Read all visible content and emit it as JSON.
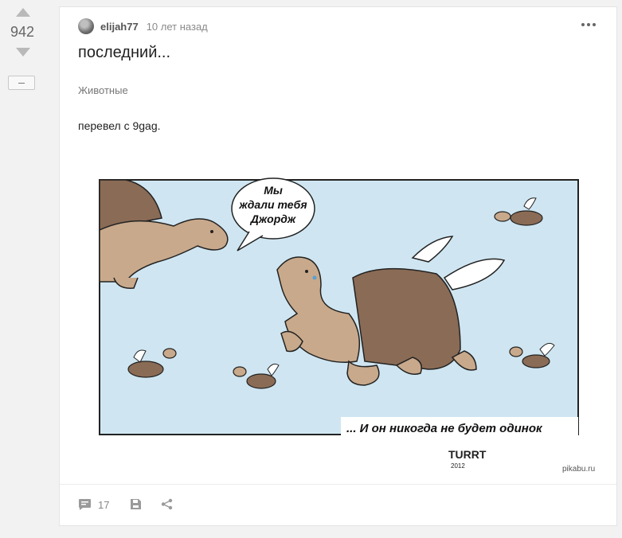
{
  "vote": {
    "rating": "942"
  },
  "post": {
    "author": "elijah77",
    "time": "10 лет назад",
    "title": "последний...",
    "tag": "Животные",
    "text": "перевел с 9gag."
  },
  "comic": {
    "bubble_lines": [
      "Мы",
      "ждали тебя",
      "Джордж"
    ],
    "caption": "... И он никогда не будет одинок",
    "signature": "TURRT",
    "signature_year": "2012",
    "watermark": "pikabu.ru"
  },
  "footer": {
    "comments_count": "17"
  },
  "icons": {
    "more": "more-dots-icon",
    "comments": "comment-icon",
    "save": "save-icon",
    "share": "share-icon"
  },
  "colors": {
    "sky": "#cfe6f2",
    "turtle_skin": "#c8a98b",
    "turtle_shell": "#8a6b55",
    "icon_gray": "#9a9a9a"
  }
}
